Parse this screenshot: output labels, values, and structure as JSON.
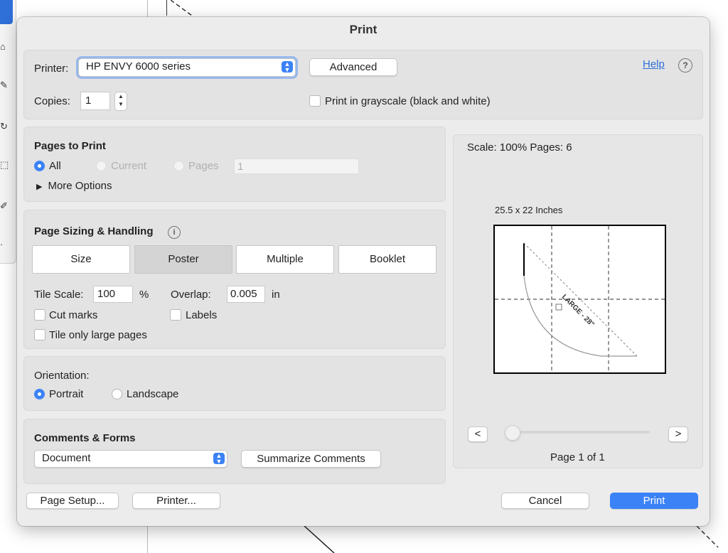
{
  "dialog": {
    "title": "Print"
  },
  "printer": {
    "label": "Printer:",
    "selected": "HP ENVY 6000 series",
    "advanced_label": "Advanced",
    "help_label": "Help",
    "help_icon": "?",
    "copies_label": "Copies:",
    "copies_value": "1",
    "grayscale_label": "Print in grayscale (black and white)",
    "grayscale_checked": false
  },
  "pages_to_print": {
    "heading": "Pages to Print",
    "all_label": "All",
    "current_label": "Current",
    "pages_label": "Pages",
    "pages_value": "1",
    "more_options_label": "More Options",
    "selected": "All"
  },
  "page_sizing": {
    "heading": "Page Sizing & Handling",
    "info_icon": "i",
    "buttons": [
      "Size",
      "Poster",
      "Multiple",
      "Booklet"
    ],
    "selected": "Poster",
    "tile_scale_label": "Tile Scale:",
    "tile_scale_value": "100",
    "percent_label": "%",
    "overlap_label": "Overlap:",
    "overlap_value": "0.005",
    "overlap_unit": "in",
    "cut_marks_label": "Cut marks",
    "labels_label": "Labels",
    "tile_large_label": "Tile only large pages"
  },
  "orientation": {
    "heading": "Orientation:",
    "portrait_label": "Portrait",
    "landscape_label": "Landscape",
    "selected": "Portrait"
  },
  "comments_forms": {
    "heading": "Comments & Forms",
    "selected": "Document",
    "summarize_label": "Summarize Comments"
  },
  "preview": {
    "scale_text": "Scale: 100% Pages: 6",
    "dimensions_text": "25.5 x 22 Inches",
    "prev_label": "<",
    "next_label": ">",
    "page_indicator": "Page 1 of 1",
    "slider_position": 0,
    "document_text": "LARGE - 28\""
  },
  "footer": {
    "page_setup_label": "Page Setup...",
    "printer_label": "Printer...",
    "cancel_label": "Cancel",
    "print_label": "Print"
  },
  "colors": {
    "accent": "#3b82f6",
    "dialog_bg": "#ececec",
    "panel_bg": "#e3e3e3"
  }
}
